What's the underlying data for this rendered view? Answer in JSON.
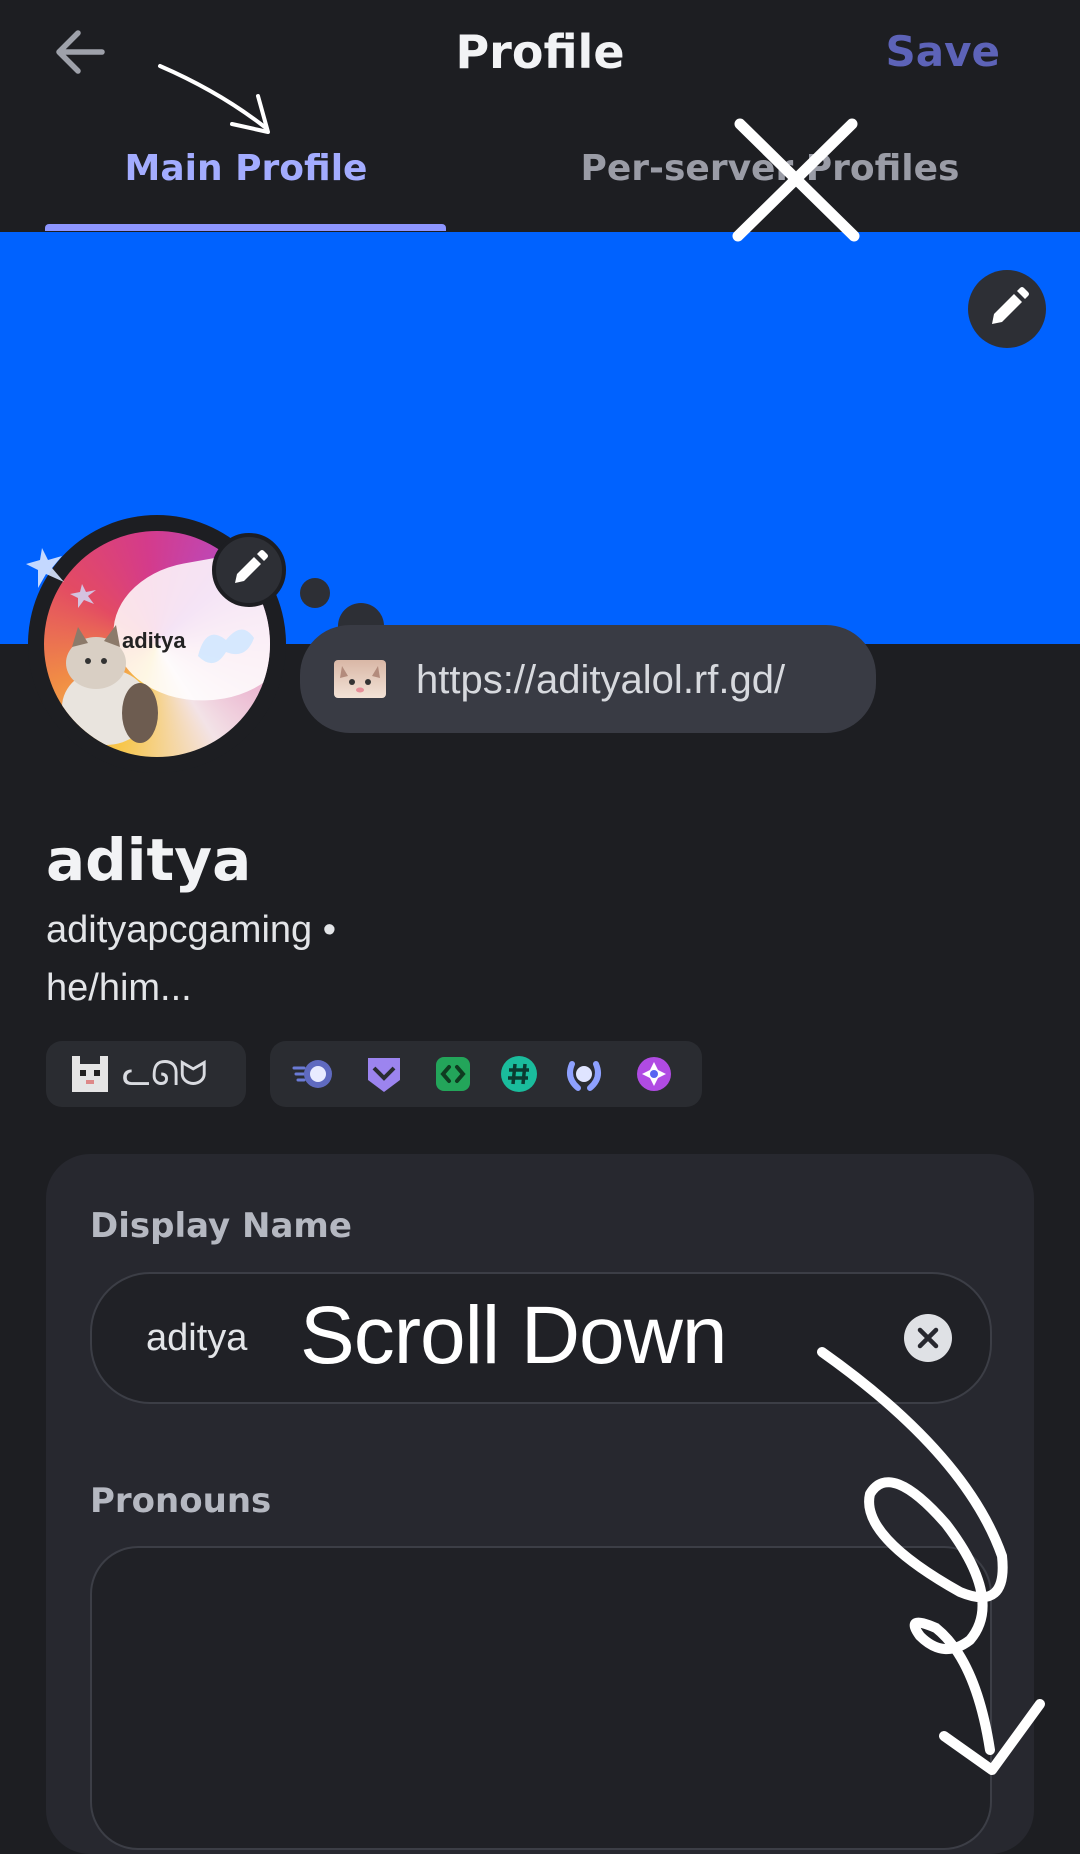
{
  "header": {
    "title": "Profile",
    "save_label": "Save",
    "back_icon": "arrow-left-icon"
  },
  "tabs": [
    {
      "label": "Main Profile",
      "active": true
    },
    {
      "label": "Per-server Profiles",
      "active": false
    }
  ],
  "banner": {
    "color": "#0062ff",
    "edit_icon": "pencil-icon"
  },
  "avatar": {
    "text": "aditya",
    "edit_icon": "pencil-icon"
  },
  "status": {
    "emoji": "cat-emoji",
    "text": "https://adityalol.rf.gd/"
  },
  "profile": {
    "display_name": "aditya",
    "username": "adityapcgaming •",
    "pronouns": "he/him..."
  },
  "chips": {
    "guild_tag_emoji": "pixel-cat-icon",
    "guild_tag_text": "ᓚᘏᗢ",
    "badges": [
      "nitro-orb-badge",
      "hypesquad-bravery-badge",
      "active-developer-badge",
      "hashtag-badge",
      "laurel-badge",
      "quest-badge"
    ]
  },
  "form": {
    "display_name_label": "Display Name",
    "display_name_value": "aditya",
    "pronouns_label": "Pronouns",
    "pronouns_value": ""
  },
  "annotations": {
    "scroll_text": "Scroll Down"
  },
  "colors": {
    "accent": "#a3acff",
    "save": "#5d63b8",
    "background": "#1d1e22"
  }
}
